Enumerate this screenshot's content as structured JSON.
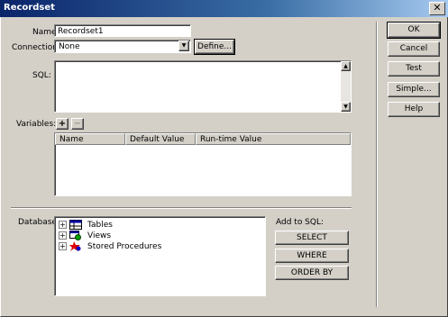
{
  "window": {
    "title": "Recordset",
    "close_label": "✕"
  },
  "form": {
    "name_label": "Name:",
    "name_value": "Recordset1",
    "connection_label": "Connection:",
    "connection_value": "None",
    "define_label": "Define...",
    "sql_label": "SQL:",
    "sql_value": ""
  },
  "variables": {
    "label": "Variables:",
    "add_label": "+",
    "remove_label": "−",
    "columns": [
      "Name",
      "Default Value",
      "Run-time Value"
    ],
    "rows": []
  },
  "database": {
    "label": "Database Items:",
    "items": [
      {
        "label": "Tables",
        "icon": "table-icon"
      },
      {
        "label": "Views",
        "icon": "view-icon"
      },
      {
        "label": "Stored Procedures",
        "icon": "stored-procedure-icon"
      }
    ]
  },
  "add_to_sql": {
    "label": "Add to SQL:",
    "buttons": [
      "SELECT",
      "WHERE",
      "ORDER BY"
    ]
  },
  "actions": {
    "ok": "OK",
    "cancel": "Cancel",
    "test": "Test",
    "simple": "Simple...",
    "help": "Help"
  },
  "colors": {
    "title_start": "#0a246a",
    "title_end": "#a6caf0",
    "face": "#d4d0c8"
  }
}
